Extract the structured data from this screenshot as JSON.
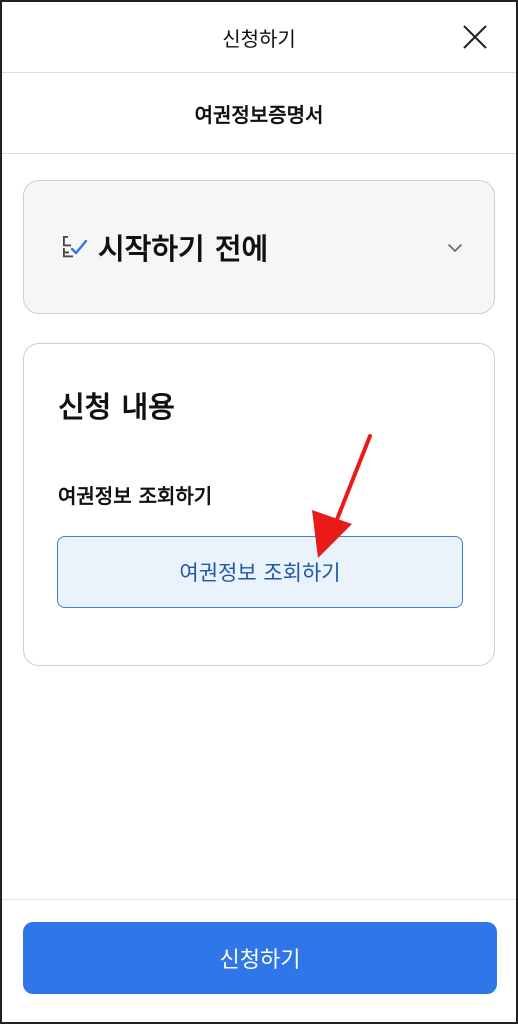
{
  "header": {
    "title": "신청하기",
    "close_icon": "close-icon"
  },
  "subheader": {
    "title": "여권정보증명서"
  },
  "before_start": {
    "title": "시작하기 전에",
    "icon": "checklist-icon",
    "expand_icon": "chevron-down-icon"
  },
  "application": {
    "title": "신청 내용",
    "field_label": "여권정보 조회하기",
    "lookup_button_label": "여권정보 조회하기"
  },
  "footer": {
    "submit_label": "신청하기"
  },
  "colors": {
    "primary": "#2f76e8",
    "lookup_bg": "#eaf2fb",
    "lookup_border": "#3f7fd4",
    "annotation_arrow": "#e81b1b"
  }
}
